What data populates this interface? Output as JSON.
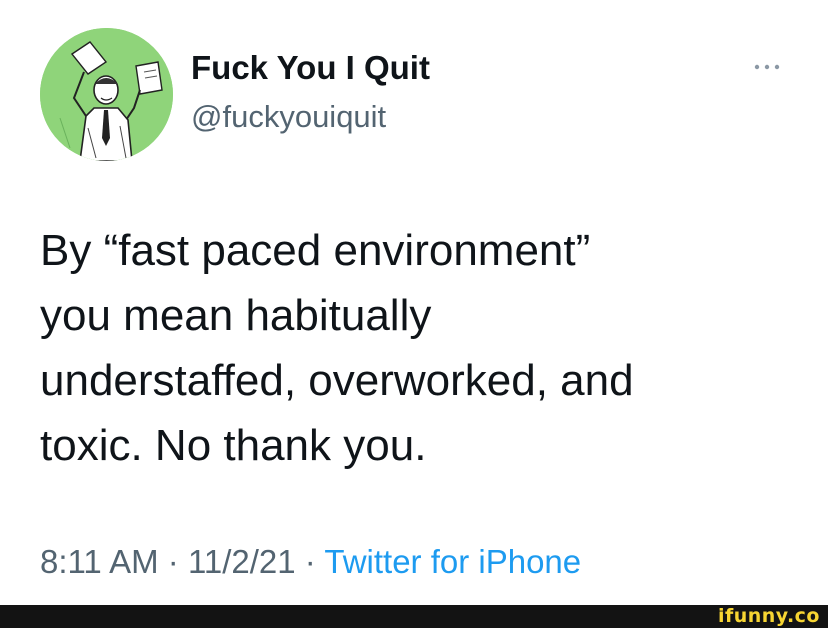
{
  "author": {
    "display_name": "Fuck You I Quit",
    "handle": "@fuckyouiquit",
    "avatar_icon": "man-throwing-papers-avatar-icon",
    "avatar_bg": "#8fd47a"
  },
  "tweet": {
    "lines": [
      "By “fast paced environment”",
      "you mean habitually",
      "understaffed, overworked, and",
      "toxic. No thank you."
    ]
  },
  "meta": {
    "time": "8:11 AM",
    "separator": " · ",
    "date": "11/2/21",
    "source": "Twitter for iPhone"
  },
  "more_icon": "more-dots-icon",
  "watermark": {
    "text": "ifunny.co",
    "color": "#f7d532"
  },
  "colors": {
    "text": "#0f1419",
    "secondary": "#536471",
    "link": "#1d9bf0"
  }
}
